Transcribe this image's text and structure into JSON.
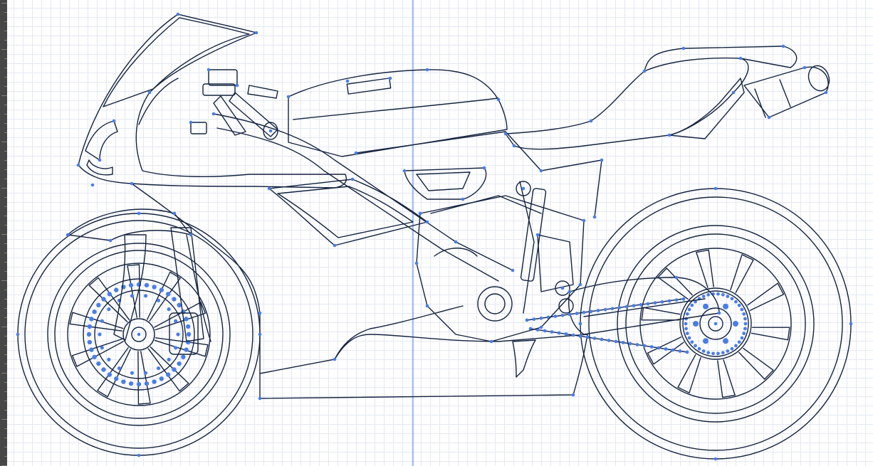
{
  "canvas": {
    "background": "#ffffff",
    "grid_color": "#c9d2e4",
    "path_color": "#14233f",
    "selection_color": "#4a7de8"
  },
  "guide": {
    "orientation": "vertical"
  },
  "drawing": {
    "subject": "motorcycle-line-art"
  }
}
